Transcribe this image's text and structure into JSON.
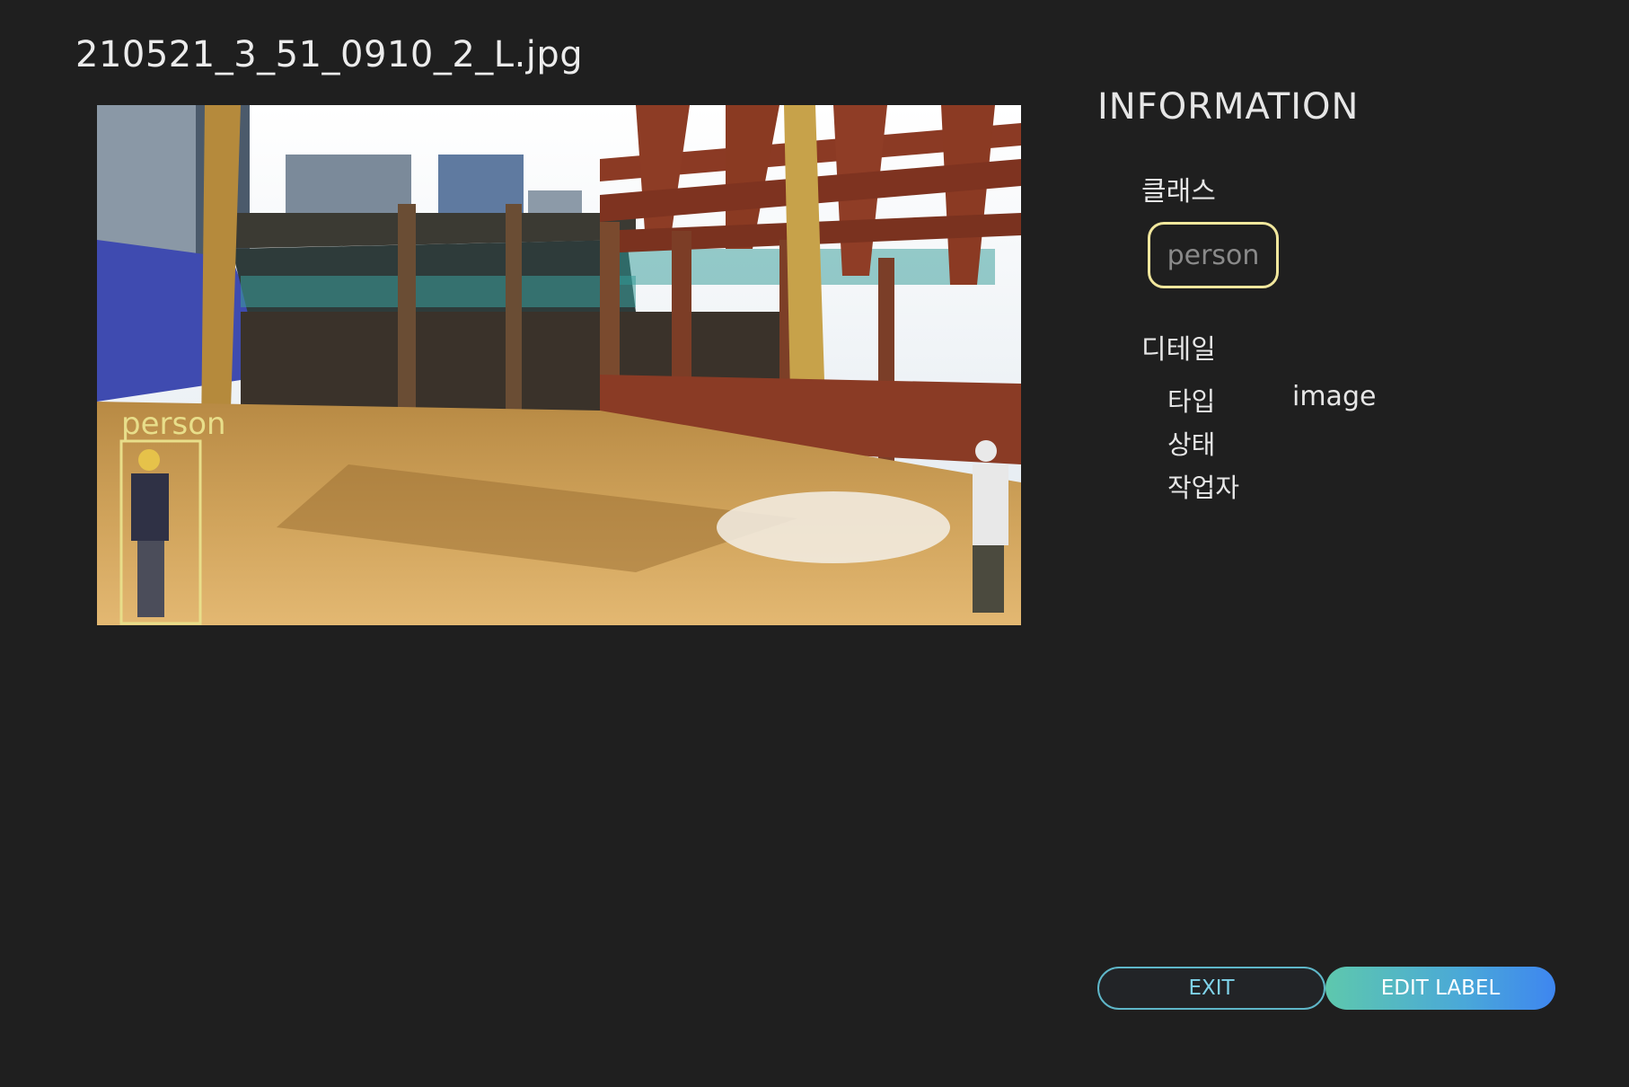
{
  "header": {
    "filename": "210521_3_51_0910_2_L.jpg"
  },
  "image": {
    "annotations": [
      {
        "label": "person",
        "color": "#e8de8a"
      }
    ]
  },
  "info": {
    "title": "INFORMATION",
    "class_label": "클래스",
    "class_value": "person",
    "detail_label": "디테일",
    "details": [
      {
        "key": "타입",
        "value": "image"
      },
      {
        "key": "상태",
        "value": ""
      },
      {
        "key": "작업자",
        "value": ""
      }
    ]
  },
  "buttons": {
    "exit": "EXIT",
    "edit": "EDIT LABEL"
  },
  "colors": {
    "background": "#1f1f1f",
    "chip_border": "#f1e79d",
    "accent": "#4aa8d8"
  }
}
